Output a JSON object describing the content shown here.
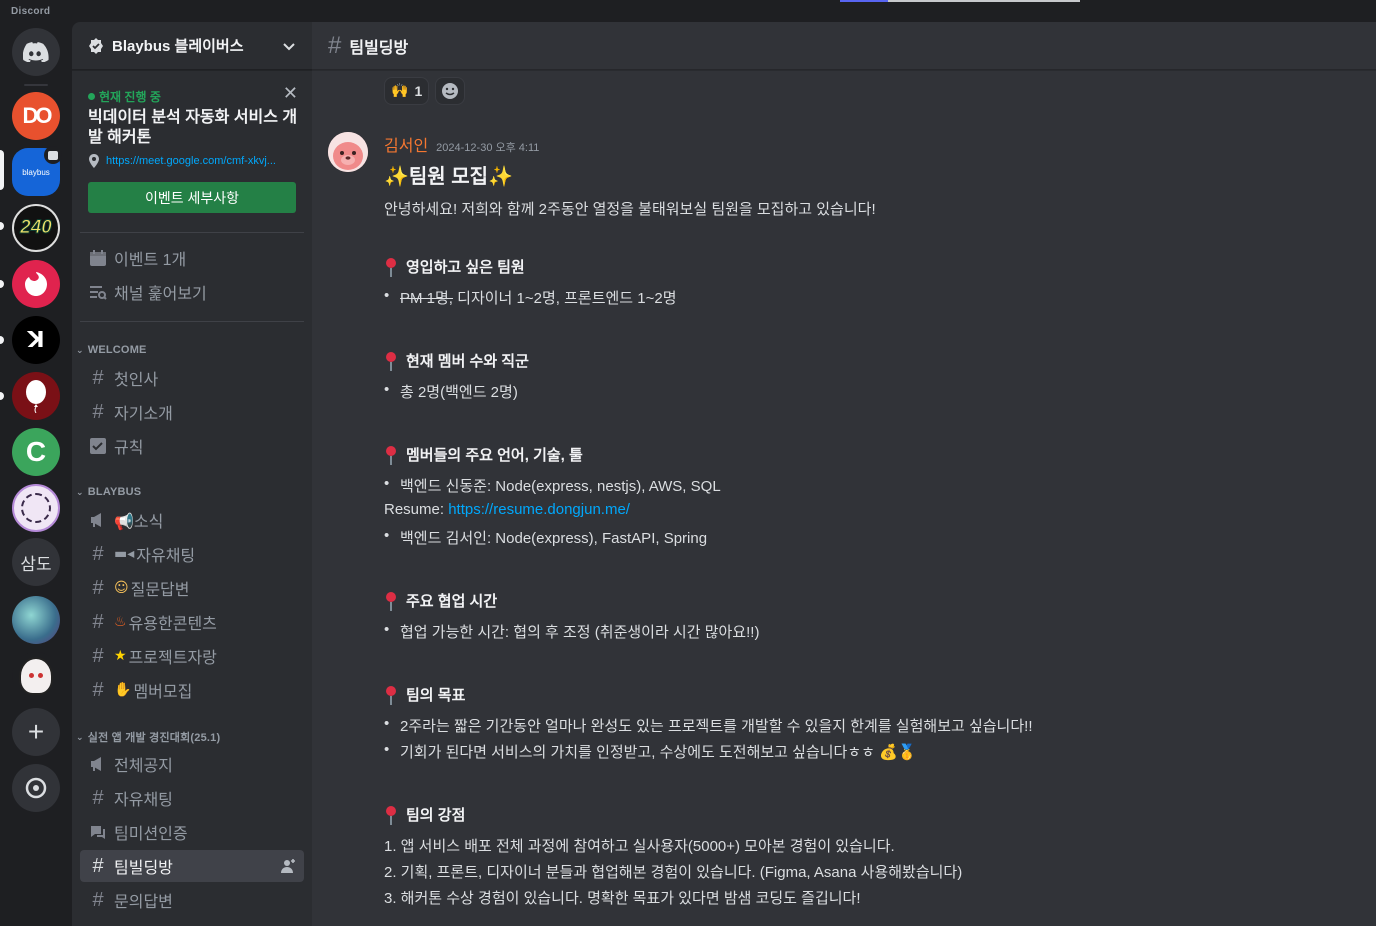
{
  "app": {
    "name": "Discord"
  },
  "rail": {
    "servers": [
      {
        "id": "home",
        "label": "Discord home"
      },
      {
        "id": "do",
        "label": "DO"
      },
      {
        "id": "blaybus",
        "label": "blaybus"
      },
      {
        "id": "240",
        "label": "240"
      },
      {
        "id": "nest",
        "label": ""
      },
      {
        "id": "k",
        "label": ""
      },
      {
        "id": "balloon",
        "label": ""
      },
      {
        "id": "c",
        "label": "C"
      },
      {
        "id": "circle",
        "label": ""
      },
      {
        "id": "samdo",
        "label": "삼도"
      },
      {
        "id": "art",
        "label": ""
      },
      {
        "id": "anime",
        "label": ""
      }
    ],
    "add_label": "+",
    "discover_label": "discover"
  },
  "guild": {
    "name": "Blaybus 블레이버스"
  },
  "event": {
    "status": "현재 진행 중",
    "title": "빅데이터 분석 자동화 서비스 개발 해커톤",
    "link": "https://meet.google.com/cmf-xkvj...",
    "button": "이벤트 세부사항"
  },
  "sidebar_top": {
    "events": "이벤트 1개",
    "browse": "채널 훑어보기"
  },
  "categories": [
    {
      "name": "WELCOME",
      "channels": [
        "첫인사",
        "자기소개",
        "규칙"
      ]
    },
    {
      "name": "BLAYBUS",
      "channels": [
        "📢소식",
        "자유채팅",
        "질문답변",
        "유용한콘텐츠",
        "프로젝트자랑",
        "멤버모집"
      ]
    },
    {
      "name": "실전 앱 개발 경진대회(25.1)",
      "channels": [
        "전체공지",
        "자유채팅",
        "팀미션인증",
        "팀빌딩방",
        "문의답변"
      ]
    }
  ],
  "channel": {
    "name": "팀빌딩방"
  },
  "reactions": [
    {
      "emoji": "🙌",
      "count": "1"
    }
  ],
  "message": {
    "author": "김서인",
    "timestamp": "2024-12-30 오후 4:11",
    "title": "✨팀원 모집✨",
    "intro": "안녕하세요! 저희와 함께 2주동안 열정을 불태워보실 팀원을 모집하고 있습니다!",
    "sections": [
      {
        "heading": "영입하고 싶은 팀원",
        "items": [
          {
            "strike": "PM 1명,",
            "text": " 디자이너 1~2명, 프론트엔드 1~2명"
          }
        ]
      },
      {
        "heading": "현재 멤버 수와 직군",
        "items": [
          {
            "text": "총 2명(백엔드 2명)"
          }
        ]
      },
      {
        "heading": "멤버들의 주요 언어, 기술, 툴",
        "item1": "백엔드 신동준: Node(express, nestjs), AWS, SQL",
        "resume_label": "Resume: ",
        "resume_link": "https://resume.dongjun.me/",
        "item2": "백엔드 김서인: Node(express), FastAPI, Spring"
      },
      {
        "heading": "주요 협업 시간",
        "items": [
          {
            "text": "협업 가능한 시간: 협의 후 조정 (취준생이라 시간 많아요!!)"
          }
        ]
      },
      {
        "heading": "팀의 목표",
        "items": [
          {
            "text": "2주라는 짧은 기간동안 얼마나 완성도 있는 프로젝트를 개발할 수 있을지 한계를 실험해보고 싶습니다!!"
          },
          {
            "text": "기회가 된다면 서비스의 가치를 인정받고, 수상에도 도전해보고 싶습니다ㅎㅎ 💰🥇"
          }
        ]
      },
      {
        "heading": "팀의 강점",
        "ordered": [
          "1. 앱 서비스 배포 전체 과정에 참여하고 실사용자(5000+) 모아본 경험이 있습니다.",
          "2. 기획, 프론트, 디자이너 분들과 협업해본 경험이 있습니다. (Figma, Asana 사용해봤습니다)",
          "3. 해커톤 수상 경험이 있습니다. 명확한 목표가 있다면 밤샘 코딩도 즐깁니다!"
        ]
      }
    ]
  },
  "colors": {
    "accent": "#5865f2",
    "green": "#23a55a",
    "author": "#f57731",
    "link": "#00a8fc"
  }
}
